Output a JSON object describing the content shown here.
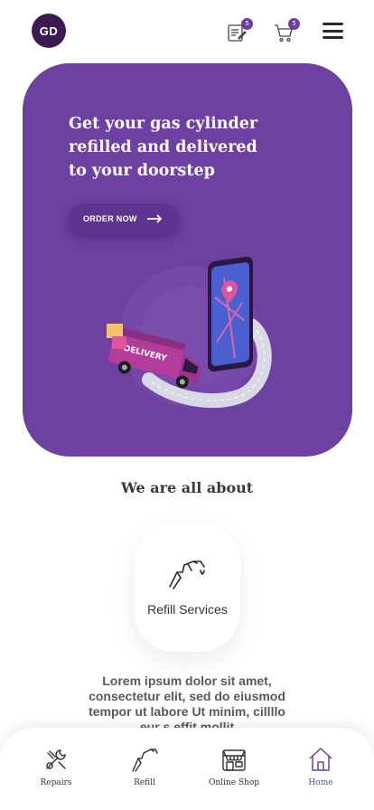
{
  "header": {
    "avatar_initials": "GD",
    "orders_icon": "order-list-icon",
    "orders_badge": "5",
    "cart_icon": "cart-icon",
    "cart_badge": "5",
    "menu_icon": "hamburger-menu-icon"
  },
  "hero": {
    "title": "Get your gas cylinder refilled and delivered to your doorstep",
    "cta_label": "ORDER NOW",
    "cta_icon": "arrow-right-icon",
    "illustration": "delivery-van-phone-map-illustration",
    "illustration_van_text": "DELIVERY",
    "background_color": "#6e40a1"
  },
  "about": {
    "title": "We are all about",
    "service": {
      "label": "Refill Services",
      "icon": "gas-nozzle-icon"
    },
    "text": "Lorem ipsum dolor sit amet, consectetur elit, sed do eiusmod tempor ut labore Ut minim, cillllo eur s effit mollit"
  },
  "bottom_nav": {
    "items": [
      {
        "label": "Repairs",
        "icon": "wrench-icon",
        "active": false
      },
      {
        "label": "Refill",
        "icon": "gas-nozzle-icon",
        "active": false
      },
      {
        "label": "Online Shop",
        "icon": "storefront-icon",
        "active": false
      },
      {
        "label": "Home",
        "icon": "home-icon",
        "active": true
      }
    ]
  },
  "colors": {
    "accent": "#6b3fa0",
    "avatar": "#3b1a52"
  }
}
